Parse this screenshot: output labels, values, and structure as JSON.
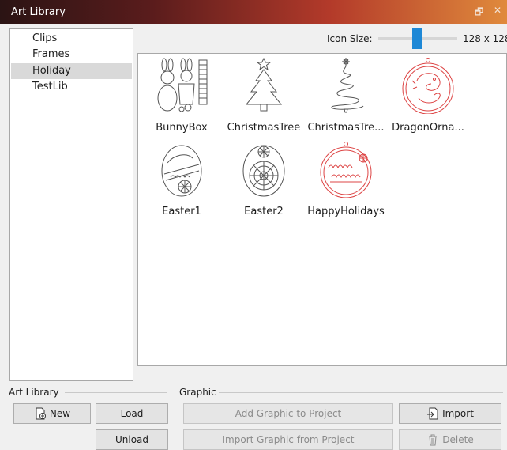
{
  "window": {
    "title": "Art Library"
  },
  "titlebar_buttons": {
    "restore_glyph": "🗗",
    "close_glyph": "✕"
  },
  "sidebar": {
    "items": [
      {
        "label": "Clips",
        "selected": false
      },
      {
        "label": "Frames",
        "selected": false
      },
      {
        "label": "Holiday",
        "selected": true
      },
      {
        "label": "TestLib",
        "selected": false
      }
    ]
  },
  "icon_size": {
    "label": "Icon Size:",
    "value": "128 x 128",
    "slider_fraction": 0.45
  },
  "graphics": [
    {
      "name": "BunnyBox",
      "icon": "bunny-box-icon"
    },
    {
      "name": "ChristmasTree",
      "icon": "christmas-tree-icon"
    },
    {
      "name": "ChristmasTre...",
      "icon": "christmas-tree-swirl-icon"
    },
    {
      "name": "DragonOrna...",
      "icon": "dragon-ornament-icon"
    },
    {
      "name": "Easter1",
      "icon": "easter-egg-icon"
    },
    {
      "name": "Easter2",
      "icon": "easter-egg-mandala-icon"
    },
    {
      "name": "HappyHolidays",
      "icon": "happy-holidays-ornament-icon"
    }
  ],
  "art_library_group": {
    "label": "Art Library",
    "new": "New",
    "load": "Load",
    "unload": "Unload"
  },
  "graphic_group": {
    "label": "Graphic",
    "add_to_project": "Add Graphic to Project",
    "import_from_project": "Import Graphic from Project",
    "import": "Import",
    "delete": "Delete"
  },
  "colors": {
    "accent": "#1e88d6",
    "selection": "#d9d9d9",
    "ornament_red": "#d44"
  }
}
